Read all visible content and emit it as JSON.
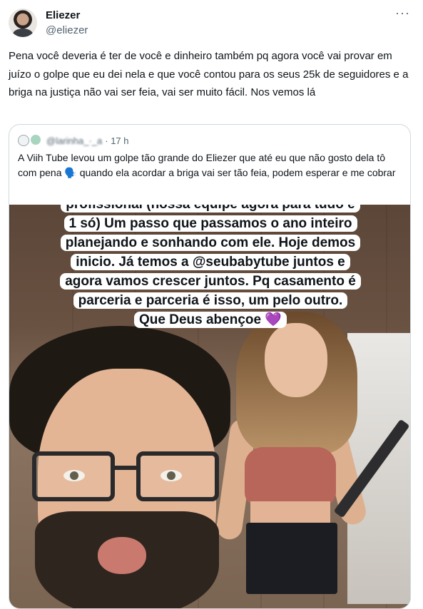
{
  "author": {
    "name": "Eliezer",
    "handle": "@eliezer",
    "avatar_icon": "profile-photo"
  },
  "more_icon": "more-dots-icon",
  "tweet": {
    "text": "Pena você deveria é ter de você e dinheiro também pq agora você vai provar em juízo o golpe que eu dei nela e que você contou para os seus 25k de seguidores e a briga na justiça não vai ser feia, vai ser muito fácil. Nos vemos lá"
  },
  "quote": {
    "handle_blurred": "@larinha_·_a",
    "time": "· 17 h",
    "text": "A Viih Tube levou um golpe tão grande do Eliezer que até eu que não gosto dela tô com pena 🗣️ quando ela acordar a briga vai ser tão feia, podem esperar e me cobrar",
    "caption_lines": [
      "profissional (nossa equipe agora para tudo é",
      "1 só) Um passo que passamos o ano inteiro",
      "planejando e sonhando com ele. Hoje demos",
      "inicio. Já temos a @seubabytube juntos e",
      "agora vamos crescer juntos. Pq casamento é",
      "parceria e parceria é isso, um pelo outro.",
      "Que Deus abençoe 💜"
    ]
  },
  "colors": {
    "text": "#0f1419",
    "secondary": "#536471",
    "border": "#cfd9de",
    "heart": "#8e4fd6"
  }
}
